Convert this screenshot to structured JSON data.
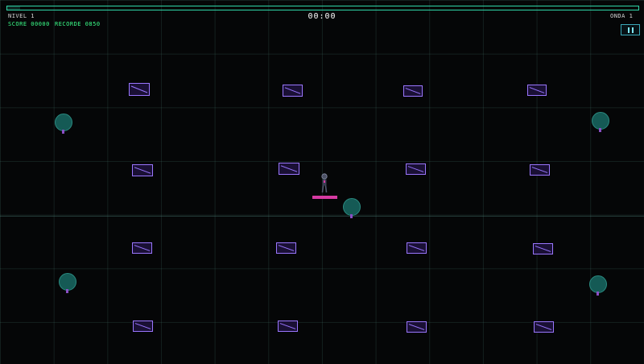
{
  "hud": {
    "level_label": "NIVEL 1",
    "score_label": "SCORE 00000",
    "record_label": "RECORDE 0850",
    "wave_label": "ONDA 1",
    "timer": "00:00",
    "top_bar_fill": 0.02
  },
  "controls": {
    "pause_icon": "pause-icon"
  },
  "colors": {
    "accent": "#2fd6a8",
    "score_green": "#3cff8a",
    "crate_purple": "#9a76ff",
    "tree_teal": "#155a55",
    "platform_pink": "#d63aa2"
  },
  "entities": {
    "crates": 16,
    "trees": 5,
    "player": "player-character",
    "platform": "platform"
  }
}
